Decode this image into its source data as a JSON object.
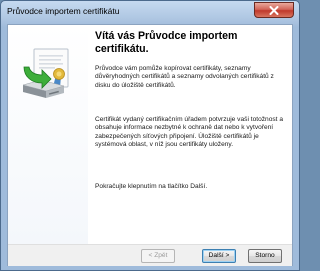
{
  "window": {
    "title": "Průvodce importem certifikátu",
    "close_glyph": "×"
  },
  "sidebar": {
    "illustration_icon": "certificate-import-icon"
  },
  "content": {
    "heading": "Vítá vás Průvodce importem certifikátu.",
    "paragraph1": "Průvodce vám pomůže kopírovat certifikáty, seznamy důvěryhodných certifikátů a seznamy odvolaných certifikátů z disku do úložiště certifikátů.",
    "paragraph2": "Certifikát vydaný certifikačním úřadem potvrzuje vaši totožnost a obsahuje informace nezbytné k ochraně dat nebo k vytvoření zabezpečených síťových připojení. Úložiště certifikátů je systémová oblast, v níž jsou certifikáty uloženy.",
    "paragraph3": "Pokračujte klepnutím na tlačítko Další."
  },
  "footer": {
    "back_label": "< Zpět",
    "next_label": "Další >",
    "cancel_label": "Storno"
  },
  "colors": {
    "titlebar": "#aec6e2",
    "close_button": "#c0392b",
    "dialog_background": "#ffffff",
    "footer_background": "#f0f0f0",
    "default_button_border": "#3c7fb1"
  }
}
